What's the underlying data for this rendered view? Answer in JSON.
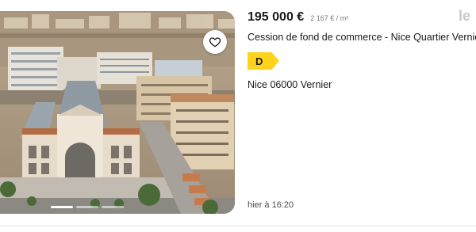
{
  "listing": {
    "price": "195 000 €",
    "price_per_m2": "2 167 € / m²",
    "title": "Cession de fond de commerce - Nice Quartier Vernier",
    "energy_class": "D",
    "location": "Nice 06000 Vernier",
    "date": "hier à 16:20"
  },
  "photo": {
    "favorite_icon": "heart-icon",
    "image_count_shown": 3,
    "active_index": 0
  },
  "brand": {
    "partial_logo": "le"
  },
  "colors": {
    "energy_badge": "#ffd21c",
    "price_text": "#1a1a1a",
    "secondary_text": "#7a7a7a"
  }
}
